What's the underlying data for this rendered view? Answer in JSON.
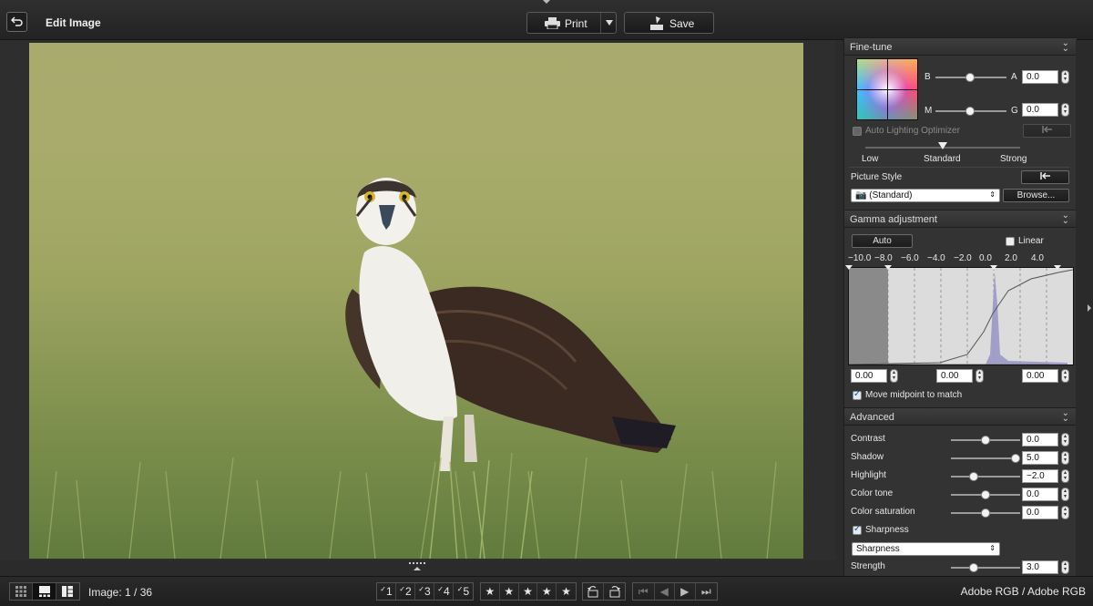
{
  "topbar": {
    "title": "Edit Image",
    "print_label": "Print",
    "save_label": "Save"
  },
  "fine_tune": {
    "header": "Fine-tune",
    "b_label": "B",
    "a_label": "A",
    "ba_value": "0.0",
    "m_label": "M",
    "g_label": "G",
    "mg_value": "0.0",
    "alo_label": "Auto Lighting Optimizer",
    "alo_levels": [
      "Low",
      "Standard",
      "Strong"
    ],
    "picture_style_label": "Picture Style",
    "picture_style_value": "(Standard)",
    "browse_label": "Browse..."
  },
  "gamma": {
    "header": "Gamma adjustment",
    "auto_label": "Auto",
    "linear_label": "Linear",
    "scale_ticks": [
      "−10.0",
      "−8.0",
      "−6.0",
      "−4.0",
      "−2.0",
      "0.0",
      "2.0",
      "4.0"
    ],
    "left_value": "0.00",
    "mid_value": "0.00",
    "right_value": "0.00",
    "move_midpoint_label": "Move midpoint to match",
    "move_midpoint_checked": true
  },
  "advanced": {
    "header": "Advanced",
    "rows": [
      {
        "label": "Contrast",
        "value": "0.0",
        "level": 0.5
      },
      {
        "label": "Shadow",
        "value": "5.0",
        "level": 1.0
      },
      {
        "label": "Highlight",
        "value": "−2.0",
        "level": 0.3
      },
      {
        "label": "Color tone",
        "value": "0.0",
        "level": 0.5
      },
      {
        "label": "Color saturation",
        "value": "0.0",
        "level": 0.5
      }
    ],
    "sharpness_label": "Sharpness",
    "sharpness_select": "Sharpness",
    "strength_label": "Strength",
    "strength_value": "3.0",
    "strength_level": 0.3
  },
  "bottombar": {
    "image_label": "Image:",
    "image_current": "1",
    "image_total": "36",
    "image_count_text": "Image: 1 / 36",
    "check_marks": [
      "1",
      "2",
      "3",
      "4",
      "5"
    ],
    "stars": [
      "★",
      "★",
      "★",
      "★",
      "★"
    ],
    "color_space": "Adobe RGB / Adobe RGB"
  }
}
